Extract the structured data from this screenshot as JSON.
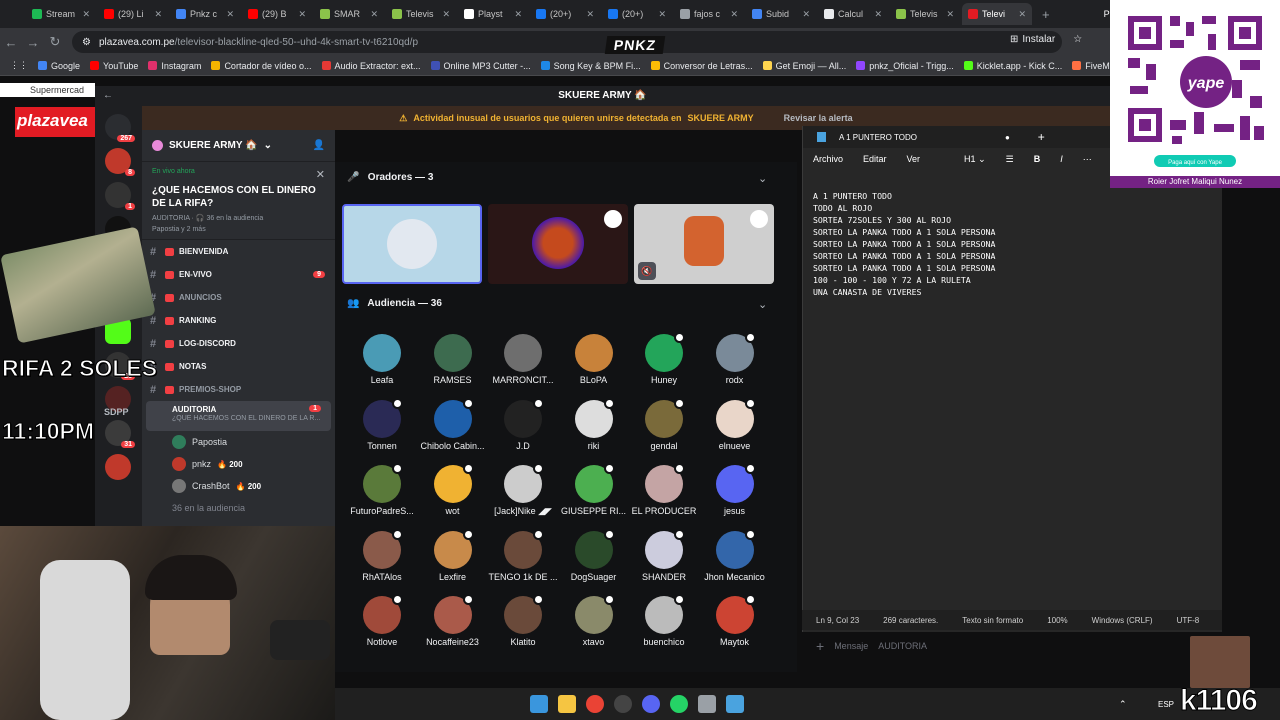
{
  "browser": {
    "tabs": [
      "Stream",
      "(29) Li",
      "Pnkz c",
      "(29) B",
      "SMAR",
      "Televis",
      "Playst",
      "(20+)",
      "(20+)",
      "fajos c",
      "Subid",
      "Calcul",
      "Televis",
      "Televi"
    ],
    "tab_colors": [
      "#1db954",
      "#ff0000",
      "#4285f4",
      "#ff0000",
      "#8bc34a",
      "#8bc34a",
      "#ffffff",
      "#1877f2",
      "#1877f2",
      "#9aa0a6",
      "#4285f4",
      "#e8eaed",
      "#8bc34a",
      "#e21b23"
    ],
    "active_tab_index": 13,
    "new_tab_glyph": "+",
    "extra_tab": "Pre",
    "url_host": "plazavea.com.pe",
    "url_path": "/televisor-blackline-qled-50--uhd-4k-smart-tv-t6210qd/p",
    "install_label": "Instalar",
    "logo_overlay": "PNKZ",
    "bookmarks": [
      "Google",
      "YouTube",
      "Instagram",
      "Cortador de vídeo o...",
      "Audio Extractor: ext...",
      "Online MP3 Cutter -...",
      "Song Key & BPM Fi...",
      "Conversor de Letras...",
      "Get Emoji — All...",
      "pnkz_Oficial - Trigg...",
      "Kicklet.app - Kick C...",
      "FiveM Documentat"
    ]
  },
  "plazavea": {
    "tab_label": "Supermercad",
    "logo": "plazavea"
  },
  "discord": {
    "window_title": "SKUERE ARMY 🏠",
    "alert_text": "Actividad inusual de usuarios que quieren unirse detectada en",
    "alert_server": "SKUERE ARMY",
    "alert_action": "Revisar la alerta",
    "server_name": "SKUERE ARMY 🏠",
    "server_badges": [
      "267",
      "8",
      "1",
      "",
      "",
      "2",
      "",
      "28",
      "",
      "31",
      ""
    ],
    "event": {
      "live": "En vivo ahora",
      "title": "¿QUE HACEMOS CON EL DINERO DE LA RIFA?",
      "meta": "AUDITORIA · 🎧 36 en la audiencia",
      "people": "Papostia y 2 más"
    },
    "channels": [
      {
        "name": "BIENVENIDA",
        "white": true,
        "badge": ""
      },
      {
        "name": "EN-VIVO",
        "white": true,
        "badge": "9"
      },
      {
        "name": "ANUNCIOS",
        "white": false,
        "badge": ""
      },
      {
        "name": "RANKING",
        "white": true,
        "badge": ""
      },
      {
        "name": "LOG-DISCORD",
        "white": true,
        "badge": ""
      },
      {
        "name": "NOTAS",
        "white": true,
        "badge": ""
      },
      {
        "name": "PREMIOS-SHOP",
        "white": false,
        "badge": ""
      }
    ],
    "selected_channel": {
      "name": "AUDITORIA",
      "sub": "¿QUE HACEMOS CON EL DINERO DE LA R...",
      "badge": "1"
    },
    "voice_users": [
      {
        "name": "Papostia",
        "extra": ""
      },
      {
        "name": "pnkz",
        "extra": "🔥 200"
      },
      {
        "name": "CrashBot",
        "extra": "🔥 200"
      }
    ],
    "audience_footer": "36 en la audiencia",
    "speakers_header": "Oradores — 3",
    "audience_header": "Audiencia — 36",
    "audience": [
      "Leafa",
      "RAMSES",
      "MARRONCIT...",
      "BLoPA",
      "Huney",
      "rodx",
      "Tonnen",
      "Chibolo Cabin...",
      "J.D",
      "riki",
      "gendal",
      "elnueve",
      "FuturoPadreS...",
      "wot",
      "[Jack]Nike ◢◤",
      "GIUSEPPE RI...",
      "EL PRODUCER",
      "jesus",
      "RhATAlos",
      "Lexfire",
      "TENGO 1k DE ...",
      "DogSuager",
      "SHANDER",
      "Jhon Mecanico",
      "Notlove",
      "Nocaffeine23",
      "Klatito",
      "xtavo",
      "buenchico",
      "Maytok"
    ],
    "message_placeholder": "Mensaje",
    "message_channel": "AUDITORIA"
  },
  "notepad": {
    "tab_title": "A 1 PUNTERO TODO",
    "menu": [
      "Archivo",
      "Editar",
      "Ver"
    ],
    "heading_menu": "H1",
    "lines": [
      "A 1 PUNTERO TODO",
      "TODO AL ROJO",
      "SORTEA 72SOLES Y 300 AL ROJO",
      "SORTEO LA PANKA TODO A 1 SOLA PERSONA",
      "SORTEO LA PANKA TODO A 1 SOLA PERSONA",
      "SORTEO LA PANKA TODO A 1 SOLA PERSONA",
      "SORTEO LA PANKA TODO A 1 SOLA PERSONA",
      "100 - 100 - 100 Y 72 A LA RULETA",
      "UNA CANASTA DE VIVERES"
    ],
    "status": {
      "position": "Ln 9, Col 23",
      "chars": "269 caracteres.",
      "format": "Texto sin formato",
      "zoom": "100%",
      "eol": "Windows (CRLF)",
      "encoding": "UTF-8"
    }
  },
  "overlay": {
    "rifa": "RIFA 2 SOLES",
    "clock": "11:10PM",
    "sdpp": "SDPP",
    "qr_name": "Roier Jofret Maliqui Nunez",
    "qr_caption": "Paga aquí con Yape",
    "qr_brand": "yape",
    "viewers": "k1106",
    "lang": "ESP"
  }
}
